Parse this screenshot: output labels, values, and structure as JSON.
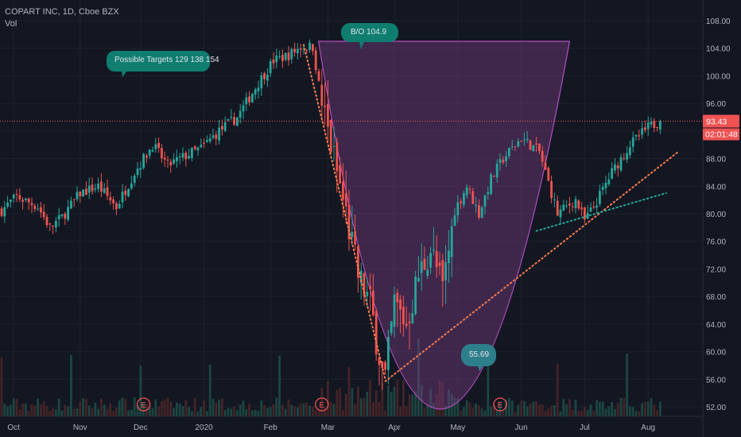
{
  "header": {
    "symbol_line": "COPART INC, 1D, Cboe BZX",
    "volume_label": "Vol"
  },
  "annotations": {
    "targets": "Possible Targets  129  138  154",
    "breakout": "B/O 104.9",
    "low": "55.69"
  },
  "event_marker_label": "E",
  "colors": {
    "background": "#131722",
    "up": "#26a69a",
    "down": "#ef5350",
    "cup_fill": "#7b3f86",
    "cup_stroke": "#b04fc0",
    "targets_bubble": "#0f7d70",
    "low_bubble": "#2e7f8c",
    "price_badge": "#f05252",
    "grid": "#1e222d",
    "text": "#b2b5be",
    "trend_orange": "#f57c4f",
    "trend_teal": "#26a69a"
  },
  "chart_data": {
    "type": "candlestick",
    "title": "COPART INC, 1D, Cboe BZX",
    "y_ticks": [
      "52.00",
      "56.00",
      "60.00",
      "64.00",
      "68.00",
      "72.00",
      "76.00",
      "80.00",
      "84.00",
      "88.00",
      "92.00",
      "96.00",
      "100.00",
      "104.00",
      "108.00"
    ],
    "ylim": [
      51,
      110
    ],
    "x_tick_labels": [
      "Oct",
      "Nov",
      "Dec",
      "2020",
      "Feb",
      "Mar",
      "Apr",
      "May",
      "Jun",
      "Jul",
      "Aug"
    ],
    "x_tick_days": [
      4,
      26,
      46,
      67,
      89,
      108,
      130,
      151,
      172,
      193,
      214
    ],
    "last_price": "93.43",
    "last_price_value": 93.43,
    "countdown": "02:01:48",
    "price_path": [
      [
        0,
        80.5
      ],
      [
        5,
        82.5
      ],
      [
        12,
        81
      ],
      [
        16,
        78
      ],
      [
        20,
        79.5
      ],
      [
        26,
        83
      ],
      [
        32,
        84
      ],
      [
        38,
        81
      ],
      [
        44,
        86
      ],
      [
        50,
        90
      ],
      [
        55,
        87
      ],
      [
        60,
        88.2
      ],
      [
        66,
        89.5
      ],
      [
        72,
        92
      ],
      [
        78,
        94
      ],
      [
        85,
        99
      ],
      [
        90,
        102.2
      ],
      [
        95,
        103
      ],
      [
        99,
        104.2
      ],
      [
        103,
        104.2
      ],
      [
        106,
        96
      ],
      [
        110,
        88
      ],
      [
        114,
        80
      ],
      [
        118,
        71
      ],
      [
        122,
        67
      ],
      [
        126,
        57
      ],
      [
        127,
        56
      ],
      [
        130,
        67
      ],
      [
        134,
        64
      ],
      [
        138,
        71
      ],
      [
        142,
        75
      ],
      [
        146,
        69
      ],
      [
        150,
        80.5
      ],
      [
        154,
        84
      ],
      [
        158,
        80
      ],
      [
        162,
        85
      ],
      [
        166,
        88
      ],
      [
        172,
        91
      ],
      [
        178,
        89
      ],
      [
        184,
        80
      ],
      [
        190,
        82
      ],
      [
        193,
        79
      ],
      [
        196,
        81
      ],
      [
        202,
        86
      ],
      [
        208,
        90
      ],
      [
        214,
        92.5
      ],
      [
        218,
        93.5
      ]
    ],
    "cup_pattern": {
      "left_rim": [
        104.9,
        105
      ],
      "right_rim": [
        188,
        105
      ],
      "bottom": [
        144,
        52.2
      ]
    },
    "breakout_level": 104.9,
    "low_level": 55.69,
    "earnings_days": [
      47,
      106,
      165
    ],
    "trend_lines": [
      {
        "name": "decline",
        "points": [
          [
            100,
            104.5
          ],
          [
            127,
            56
          ]
        ]
      },
      {
        "name": "support",
        "points": [
          [
            127,
            55.7
          ],
          [
            224,
            89
          ]
        ]
      },
      {
        "name": "channel",
        "points": [
          [
            177,
            77.5
          ],
          [
            220,
            83
          ]
        ]
      }
    ],
    "volume_note": "daily volume bars"
  }
}
